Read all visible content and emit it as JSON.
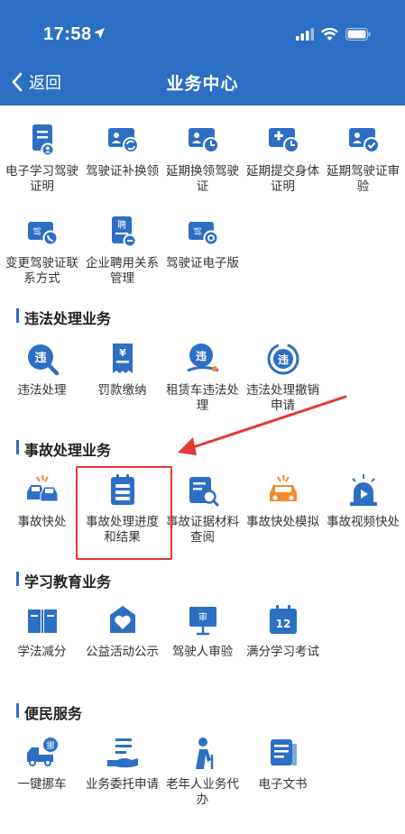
{
  "status": {
    "time": "17:58"
  },
  "nav": {
    "back_label": "返回",
    "title": "业务中心"
  },
  "colors": {
    "header": "#2d6fc4",
    "icon_blue": "#2d6fc4",
    "icon_orange": "#f28a2e",
    "highlight": "#e53935"
  },
  "groups": [
    {
      "items": [
        {
          "label": "电子学习驾驶证明",
          "icon": "license-doc-icon"
        },
        {
          "label": "驾驶证补换领",
          "icon": "license-swap-icon"
        },
        {
          "label": "延期换领驾驶证",
          "icon": "license-clock-icon"
        },
        {
          "label": "延期提交身体证明",
          "icon": "medical-clock-icon"
        },
        {
          "label": "延期驾驶证审验",
          "icon": "license-check-icon"
        },
        {
          "label": "变更驾驶证联系方式",
          "icon": "license-phone-icon"
        },
        {
          "label": "企业聘用关系管理",
          "icon": "employ-doc-icon"
        },
        {
          "label": "驾驶证电子版",
          "icon": "license-digital-icon"
        }
      ]
    },
    {
      "title": "违法处理业务",
      "items": [
        {
          "label": "违法处理",
          "icon": "violation-search-icon"
        },
        {
          "label": "罚款缴纳",
          "icon": "fine-receipt-icon"
        },
        {
          "label": "租赁车违法处理",
          "icon": "rental-violation-icon"
        },
        {
          "label": "违法处理撤销申请",
          "icon": "violation-cancel-icon"
        }
      ]
    },
    {
      "title": "事故处理业务",
      "items": [
        {
          "label": "事故快处",
          "icon": "car-crash-icon"
        },
        {
          "label": "事故处理进度和结果",
          "icon": "progress-list-icon"
        },
        {
          "label": "事故证据材料查阅",
          "icon": "evidence-search-icon"
        },
        {
          "label": "事故快处模拟",
          "icon": "crash-sim-icon"
        },
        {
          "label": "事故视频快处",
          "icon": "video-alarm-icon"
        }
      ]
    },
    {
      "title": "学习教育业务",
      "items": [
        {
          "label": "学法减分",
          "icon": "book-icon"
        },
        {
          "label": "公益活动公示",
          "icon": "charity-heart-icon"
        },
        {
          "label": "驾驶人审验",
          "icon": "review-board-icon"
        },
        {
          "label": "满分学习考试",
          "icon": "calendar-12-icon",
          "badge": "12"
        }
      ]
    },
    {
      "title": "便民服务",
      "items": [
        {
          "label": "一键挪车",
          "icon": "tow-truck-icon",
          "badge": "挪"
        },
        {
          "label": "业务委托申请",
          "icon": "delegate-hand-icon"
        },
        {
          "label": "老年人业务代办",
          "icon": "elder-person-icon"
        },
        {
          "label": "电子文书",
          "icon": "e-document-icon"
        }
      ]
    }
  ],
  "icon_badges": {
    "license_phone": "驾",
    "employ": "聘",
    "license_digital": "驾",
    "violation": "违",
    "fine": "¥",
    "review": "审"
  }
}
